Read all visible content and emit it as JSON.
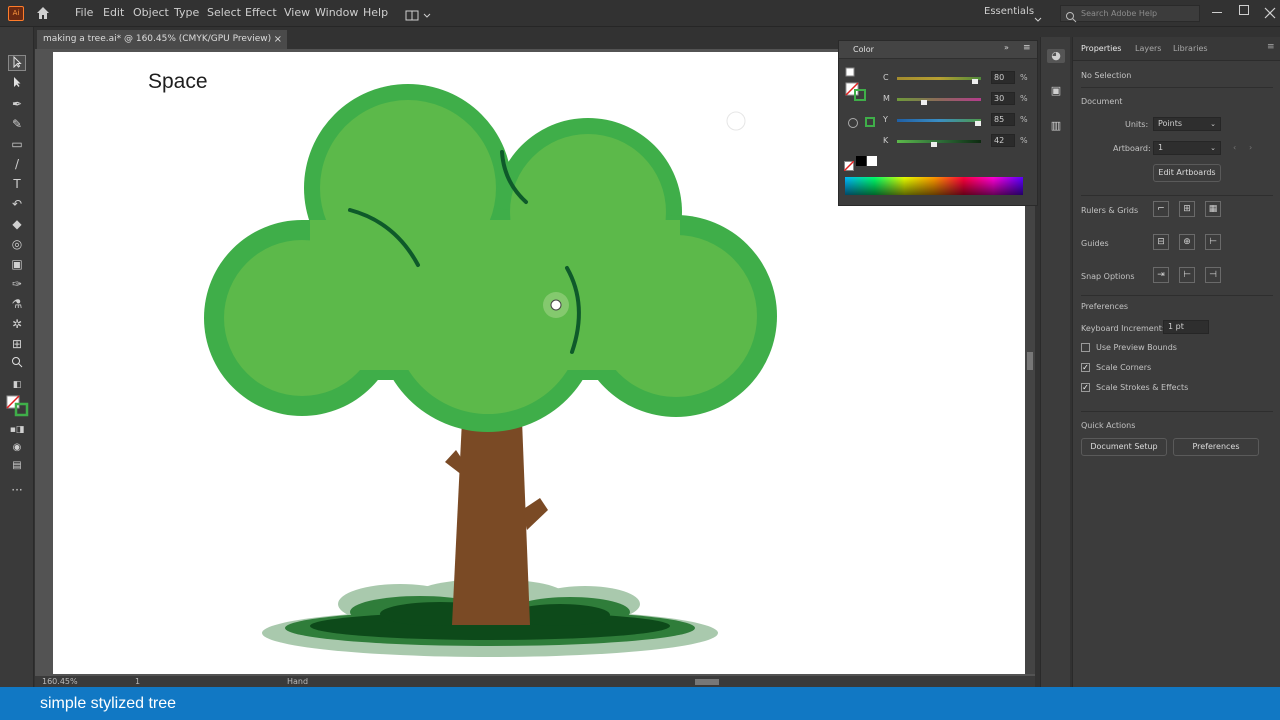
{
  "app": {
    "logo": "Ai",
    "menu": [
      "File",
      "Edit",
      "Object",
      "Type",
      "Select",
      "Effect",
      "View",
      "Window",
      "Help"
    ],
    "workspace": "Essentials",
    "search_placeholder": "Search Adobe Help"
  },
  "document": {
    "tab_title": "making a tree.ai* @ 160.45% (CMYK/GPU Preview)",
    "artboard_text": "Space",
    "zoom": "160.45%",
    "artboard_number": "1",
    "status": "Hand"
  },
  "color_panel": {
    "title": "Color",
    "channels": [
      {
        "label": "C",
        "value": "80",
        "level": 0.8,
        "color": "#b7a032"
      },
      {
        "label": "M",
        "value": "30",
        "level": 0.3,
        "color": "#b43c8c"
      },
      {
        "label": "Y",
        "value": "85",
        "level": 0.85,
        "color": "#3a8ec4"
      },
      {
        "label": "K",
        "value": "42",
        "level": 0.42,
        "color": "#2f6f3a"
      }
    ],
    "percent": "%"
  },
  "properties": {
    "tabs": [
      "Properties",
      "Layers",
      "Libraries"
    ],
    "selection": "No Selection",
    "document_section": "Document",
    "units_label": "Units:",
    "units_value": "Points",
    "artboard_label": "Artboard:",
    "artboard_value": "1",
    "edit_artboards": "Edit Artboards",
    "rulers_grids": "Rulers & Grids",
    "guides": "Guides",
    "snap_options": "Snap Options",
    "preferences_section": "Preferences",
    "keyboard_increment_label": "Keyboard Increment:",
    "keyboard_increment_value": "1 pt",
    "use_preview_bounds": "Use Preview Bounds",
    "scale_corners": "Scale Corners",
    "scale_strokes": "Scale Strokes & Effects",
    "quick_actions": "Quick Actions",
    "document_setup": "Document Setup",
    "preferences_button": "Preferences"
  },
  "caption": "simple stylized tree",
  "colors": {
    "canopy_outer": "#3fae49",
    "canopy_inner": "#5cb94a",
    "branch_lines": "#0e5a2a",
    "trunk": "#7a4a25",
    "ground_light": "#a9c9ad",
    "ground_mid": "#2f7d3a",
    "ground_dark": "#0d4a1a",
    "caption_bar": "#1178c4"
  }
}
